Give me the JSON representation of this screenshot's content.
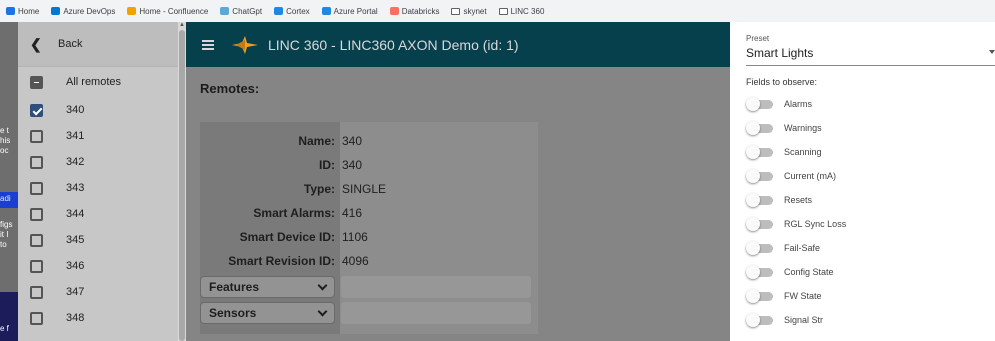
{
  "bookmarks": [
    {
      "label": "Home",
      "icon": "home-icon",
      "color": "#1a73e8"
    },
    {
      "label": "Azure DevOps",
      "icon": "azure-devops-icon",
      "color": "#0078d4"
    },
    {
      "label": "Home - Confluence",
      "icon": "confluence-icon",
      "color": "#f4a100"
    },
    {
      "label": "ChatGpt",
      "icon": "chatgpt-icon",
      "color": "#5ba8d9"
    },
    {
      "label": "Cortex",
      "icon": "cortex-icon",
      "color": "#1e88e5"
    },
    {
      "label": "Azure Portal",
      "icon": "azure-portal-icon",
      "color": "#1e88e5"
    },
    {
      "label": "Databricks",
      "icon": "databricks-icon",
      "color": "#ff6f61"
    },
    {
      "label": "skynet",
      "icon": "folder-icon",
      "color": "#5f6368"
    },
    {
      "label": "LINC 360",
      "icon": "folder-icon",
      "color": "#5f6368"
    }
  ],
  "left_page_fragments": [
    "e t",
    "his",
    "oc",
    "adi",
    "figs",
    "it I",
    "to",
    "e f"
  ],
  "sidebar": {
    "back_label": "Back",
    "all_label": "All remotes",
    "remotes": [
      {
        "label": "340",
        "checked": true
      },
      {
        "label": "341",
        "checked": false
      },
      {
        "label": "342",
        "checked": false
      },
      {
        "label": "343",
        "checked": false
      },
      {
        "label": "344",
        "checked": false
      },
      {
        "label": "345",
        "checked": false
      },
      {
        "label": "346",
        "checked": false
      },
      {
        "label": "347",
        "checked": false
      },
      {
        "label": "348",
        "checked": false
      }
    ]
  },
  "appbar": {
    "title": "LINC 360 - LINC360 AXON Demo (id: 1)",
    "bg_color": "#07404d",
    "logo_color": "#f0a020"
  },
  "main": {
    "section_title": "Remotes:",
    "details": [
      {
        "label": "Name:",
        "value": "340"
      },
      {
        "label": "ID:",
        "value": "340"
      },
      {
        "label": "Type:",
        "value": "SINGLE"
      },
      {
        "label": "Smart Alarms:",
        "value": "416"
      },
      {
        "label": "Smart Device ID:",
        "value": "1106"
      },
      {
        "label": "Smart Revision ID:",
        "value": "4096"
      }
    ],
    "accordions": [
      {
        "label": "Features"
      },
      {
        "label": "Sensors"
      }
    ]
  },
  "right_panel": {
    "preset_label": "Preset",
    "preset_value": "Smart Lights",
    "fields_label": "Fields to observe:",
    "fields": [
      {
        "label": "Alarms",
        "on": false
      },
      {
        "label": "Warnings",
        "on": false
      },
      {
        "label": "Scanning",
        "on": false
      },
      {
        "label": "Current (mA)",
        "on": false
      },
      {
        "label": "Resets",
        "on": false
      },
      {
        "label": "RGL Sync Loss",
        "on": false
      },
      {
        "label": "Fail-Safe",
        "on": false
      },
      {
        "label": "Config State",
        "on": false
      },
      {
        "label": "FW State",
        "on": false
      },
      {
        "label": "Signal Str",
        "on": false
      }
    ]
  }
}
